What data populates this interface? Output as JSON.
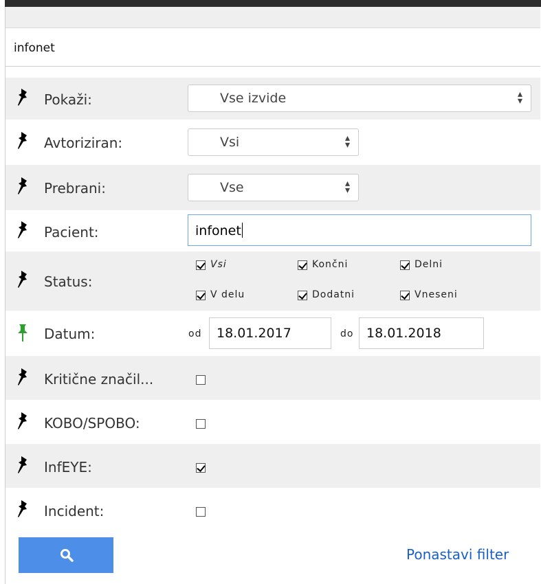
{
  "panel": {
    "title": "infonet"
  },
  "filters": [
    {
      "label": "Pokaži:",
      "type": "select",
      "value": "Vse izvide",
      "pinned": false
    },
    {
      "label": "Avtoriziran:",
      "type": "select",
      "value": "Vsi",
      "pinned": false
    },
    {
      "label": "Prebrani:",
      "type": "select",
      "value": "Vse",
      "pinned": false
    },
    {
      "label": "Pacient:",
      "type": "text",
      "value": "infonet",
      "pinned": false
    },
    {
      "label": "Status:",
      "type": "checkbox_group",
      "pinned": false,
      "options": [
        {
          "label": "Vsi",
          "checked": true
        },
        {
          "label": "Končni",
          "checked": true
        },
        {
          "label": "Delni",
          "checked": true
        },
        {
          "label": "V delu",
          "checked": true
        },
        {
          "label": "Dodatni",
          "checked": true
        },
        {
          "label": "Vneseni",
          "checked": true
        }
      ]
    },
    {
      "label": "Datum:",
      "type": "date_range",
      "pinned": true,
      "from_label": "od",
      "from_value": "18.01.2017",
      "to_label": "do",
      "to_value": "18.01.2018"
    },
    {
      "label": "Kritične značil...",
      "type": "checkbox",
      "checked": false,
      "pinned": false
    },
    {
      "label": "KOBO/SPOBO:",
      "type": "checkbox",
      "checked": false,
      "pinned": false
    },
    {
      "label": "InfEYE:",
      "type": "checkbox",
      "checked": true,
      "pinned": false
    },
    {
      "label": "Incident:",
      "type": "checkbox",
      "checked": false,
      "pinned": false
    }
  ],
  "actions": {
    "search_icon": "search-icon",
    "reset_label": "Ponastavi filter"
  },
  "colors": {
    "accent": "#4c8ee8",
    "link": "#1a5fc8",
    "pin_active": "#2e9e2e",
    "pin_inactive": "#000000",
    "row_alt": "#efefef"
  }
}
